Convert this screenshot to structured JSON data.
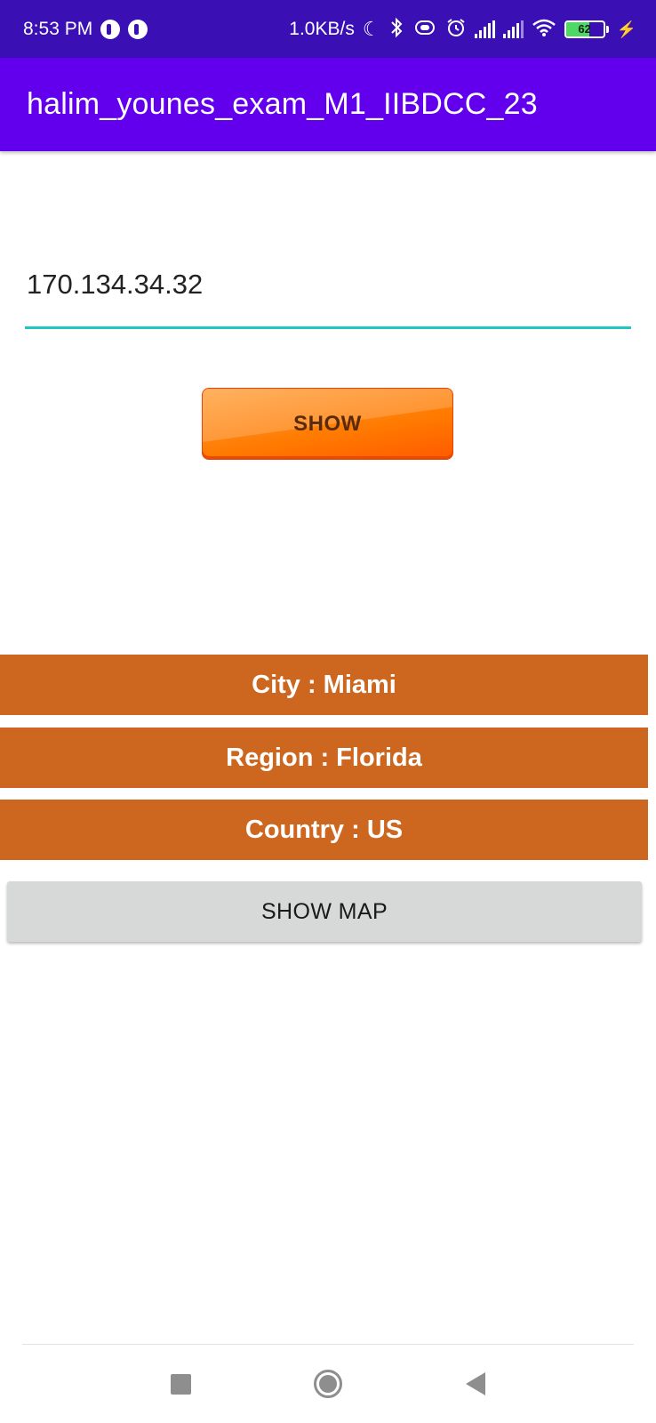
{
  "status_bar": {
    "time": "8:53 PM",
    "net_speed": "1.0KB/s",
    "battery_level": "62",
    "battery_fraction": 0.62,
    "icons": [
      "app-notification-icon",
      "app-notification-icon",
      "moon-icon",
      "bluetooth-icon",
      "vibrate-icon",
      "alarm-icon",
      "signal-icon",
      "signal-icon",
      "wifi-icon",
      "battery-icon",
      "charging-icon"
    ]
  },
  "app_bar": {
    "title": "halim_younes_exam_M1_IIBDCC_23",
    "color": "#6200ee"
  },
  "ip_input": {
    "value": "170.134.34.32",
    "underline_color": "#1fc7c0"
  },
  "show_button": {
    "label": "SHOW",
    "color": "#ff7a00"
  },
  "info": {
    "city": "City : Miami",
    "region": "Region : Florida",
    "country": "Country : US",
    "row_color": "#cd661f"
  },
  "map_button": {
    "label": "SHOW MAP"
  },
  "nav_bar": {
    "buttons": [
      "recents-square-icon",
      "home-circle-icon",
      "back-triangle-icon"
    ]
  }
}
